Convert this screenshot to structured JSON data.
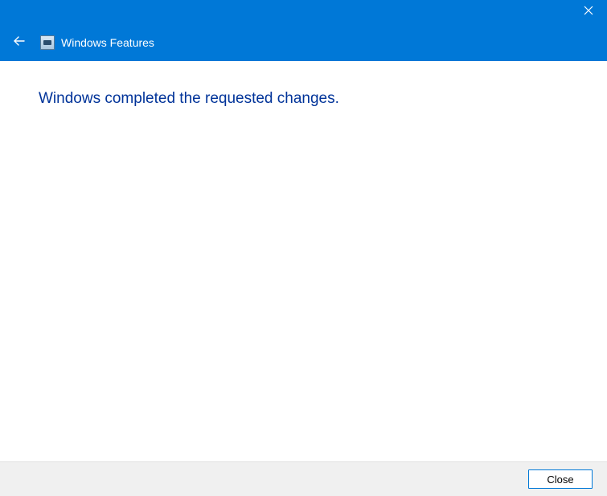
{
  "header": {
    "title": "Windows Features"
  },
  "content": {
    "message": "Windows completed the requested changes."
  },
  "footer": {
    "close_label": "Close"
  }
}
